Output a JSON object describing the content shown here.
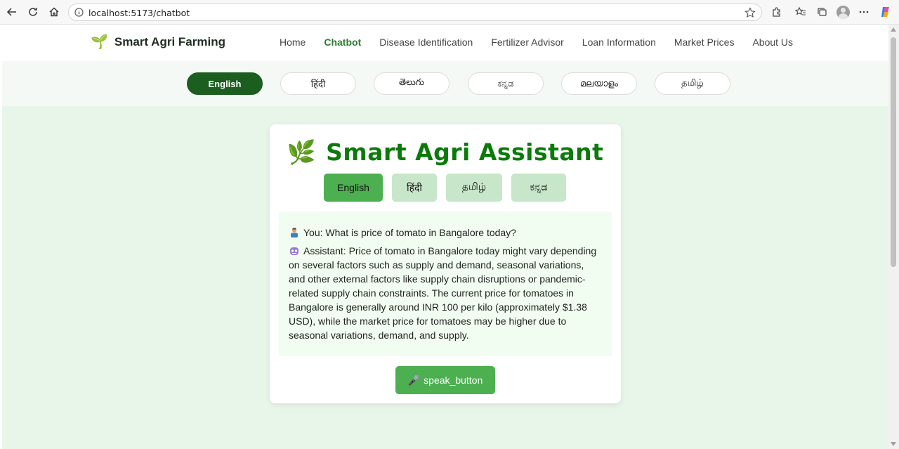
{
  "browser": {
    "url": "localhost:5173/chatbot"
  },
  "header": {
    "brand_icon": "🌱",
    "brand_name": "Smart Agri Farming",
    "nav": [
      {
        "label": "Home",
        "active": false
      },
      {
        "label": "Chatbot",
        "active": true
      },
      {
        "label": "Disease Identification",
        "active": false
      },
      {
        "label": "Fertilizer Advisor",
        "active": false
      },
      {
        "label": "Loan Information",
        "active": false
      },
      {
        "label": "Market Prices",
        "active": false
      },
      {
        "label": "About Us",
        "active": false
      }
    ]
  },
  "languages": {
    "selected": "English",
    "options": [
      "English",
      "हिंदी",
      "తెలుగు",
      "ಕನ್ನಡ",
      "മലയാളം",
      "தமிழ்"
    ]
  },
  "assistant": {
    "title_icon": "🌿",
    "title": "Smart Agri Assistant",
    "languages": [
      "English",
      "हिंदी",
      "தமிழ்",
      "ಕನ್ನಡ"
    ],
    "selected_language": "English",
    "messages": {
      "user": "You: What is price of tomato in Bangalore today?",
      "assistant": "Assistant: Price of tomato in Bangalore today might vary depending on several factors such as supply and demand, seasonal variations, and other external factors like supply chain disruptions or pandemic-related supply chain constraints. The current price for tomatoes in Bangalore is generally around INR 100 per kilo (approximately $1.38 USD), while the market price for tomatoes may be higher due to seasonal variations, demand, and supply."
    },
    "speak_icon": "🎤",
    "speak_label": "speak_button"
  },
  "colors": {
    "primary_green": "#4caf50",
    "dark_green": "#1b5e20",
    "title_green": "#0b7a0b",
    "page_bg": "#e8f5e9"
  }
}
